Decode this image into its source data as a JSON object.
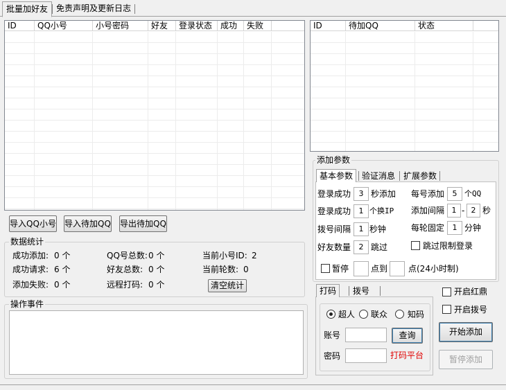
{
  "tabs": [
    "批量加好友",
    "免责声明及更新日志"
  ],
  "accounts_list": {
    "columns": [
      "ID",
      "QQ小号",
      "小号密码",
      "好友",
      "登录状态",
      "成功",
      "失败"
    ]
  },
  "pending_list": {
    "columns": [
      "ID",
      "待加QQ",
      "状态"
    ]
  },
  "buttons": {
    "import_qq": "导入QQ小号",
    "import_pending": "导入待加QQ",
    "export_pending": "导出待加QQ",
    "clear_stats": "清空统计",
    "query": "查询",
    "start": "开始添加",
    "pause": "暂停添加"
  },
  "stats": {
    "title": "数据统计",
    "success_add_label": "成功添加:",
    "success_add_value": "0 个",
    "qq_total_label": "QQ号总数:",
    "qq_total_value": "0 个",
    "current_id_label": "当前小号ID:",
    "current_id_value": "2",
    "success_req_label": "成功请求:",
    "success_req_value": "6 个",
    "friend_total_label": "好友总数:",
    "friend_total_value": "0 个",
    "current_round_label": "当前轮数:",
    "current_round_value": "0",
    "add_fail_label": "添加失败:",
    "add_fail_value": "0 个",
    "captcha_label": "远程打码:",
    "captcha_value": "0 个"
  },
  "events": {
    "title": "操作事件"
  },
  "params": {
    "title": "添加参数",
    "tabs": [
      "基本参数",
      "验证消息",
      "扩展参数"
    ],
    "login_success_label": "登录成功",
    "login_success_value": "3",
    "login_success_unit": "秒添加",
    "per_add_label": "每号添加",
    "per_add_value": "5",
    "per_add_unit": "个QQ",
    "login_success2_label": "登录成功",
    "change_ip_value": "1",
    "change_ip_unit": "个换IP",
    "add_interval_label": "添加间隔",
    "add_interval_min": "1",
    "add_interval_dash": "-",
    "add_interval_max": "2",
    "add_interval_unit": "秒",
    "dial_interval_label": "拨号间隔",
    "dial_interval_value": "1",
    "dial_interval_unit": "秒钟",
    "round_fixed_label": "每轮固定",
    "round_fixed_value": "1",
    "round_fixed_unit": "分钟",
    "friend_count_label": "好友数量",
    "friend_count_value": "2",
    "friend_count_unit": "跳过",
    "skip_limit_label": "跳过限制登录",
    "pause_label": "暂停",
    "pause_at_label": "点到",
    "pause_end_label": "点(24小时制)"
  },
  "captcha": {
    "tabs": [
      "打码",
      "拨号"
    ],
    "options": [
      "超人",
      "联众",
      "知码"
    ],
    "account_label": "账号",
    "password_label": "密码",
    "platform_label": "打码平台",
    "platform_color": "#e00000"
  },
  "toggles": {
    "enable_hongding": "开启红鼎",
    "enable_dial": "开启拨号"
  }
}
